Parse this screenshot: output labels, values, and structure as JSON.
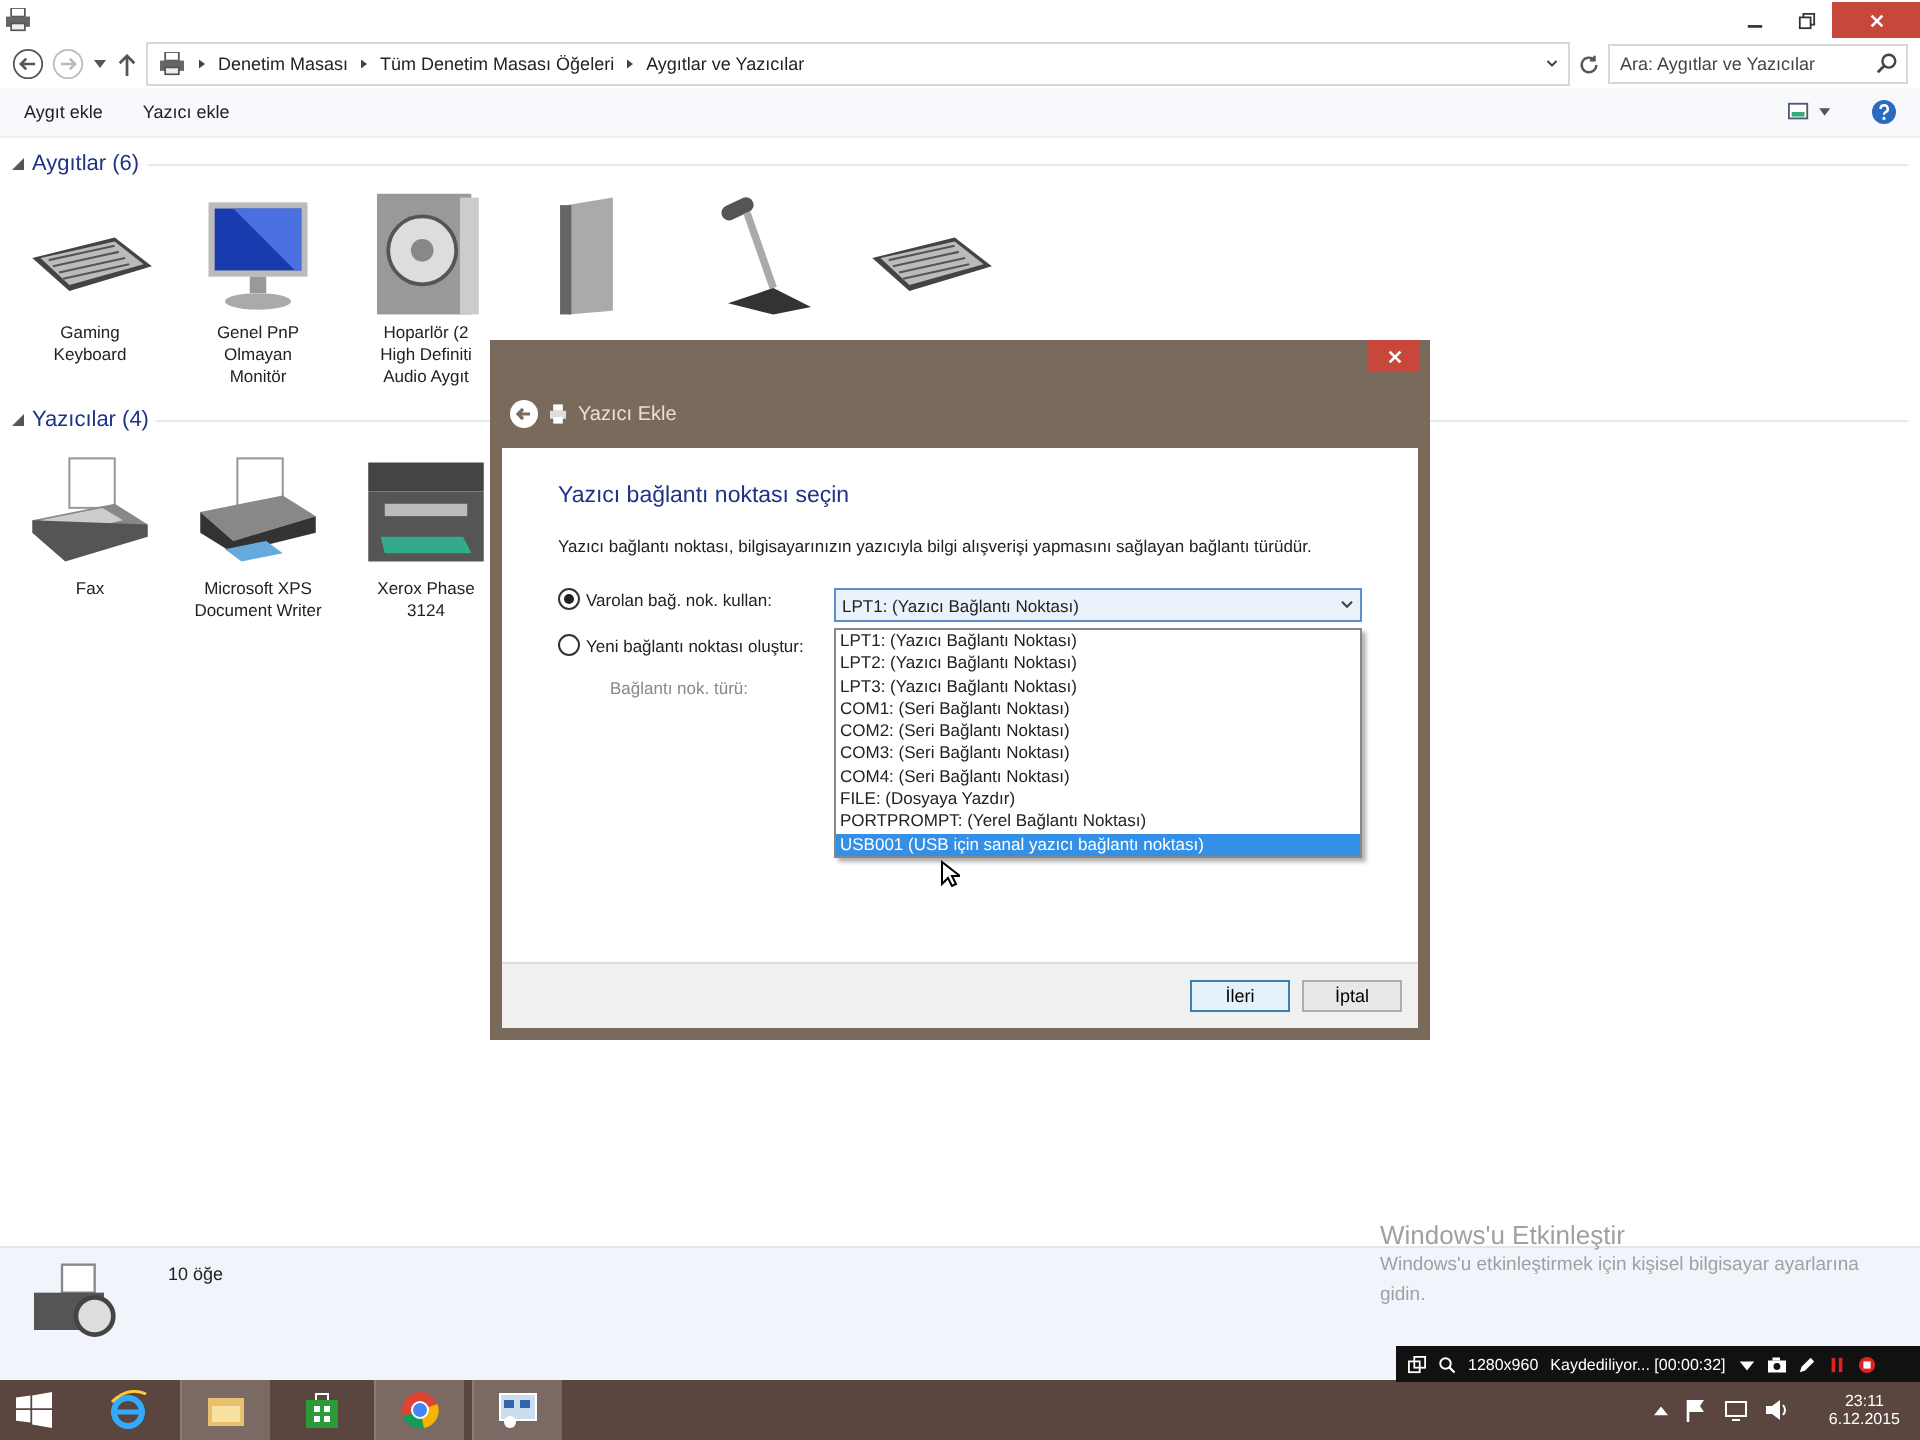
{
  "address_bar": {
    "breadcrumbs": [
      "Denetim Masası",
      "Tüm Denetim Masası Öğeleri",
      "Aygıtlar ve Yazıcılar"
    ],
    "search": {
      "placeholder": "Ara: Aygıtlar ve Yazıcılar"
    }
  },
  "command_bar": {
    "buttons": [
      "Aygıt ekle",
      "Yazıcı ekle"
    ]
  },
  "groups": [
    {
      "title": "Aygıtlar (6)",
      "items": [
        {
          "kind": "keyboard",
          "label": [
            "Gaming",
            "Keyboard"
          ]
        },
        {
          "kind": "monitor",
          "label": [
            "Genel PnP",
            "Olmayan",
            "Monitör"
          ]
        },
        {
          "kind": "speaker",
          "label": [
            "Hoparlör (2",
            "High Definiti",
            "Audio Aygıt"
          ]
        },
        {
          "kind": "tower"
        },
        {
          "kind": "microphone"
        },
        {
          "kind": "keyboard"
        }
      ]
    },
    {
      "title": "Yazıcılar (4)",
      "items": [
        {
          "kind": "fax",
          "label": [
            "Fax"
          ]
        },
        {
          "kind": "printer",
          "label": [
            "Microsoft XPS",
            "Document Writer"
          ]
        },
        {
          "kind": "mfp",
          "label": [
            "Xerox Phase",
            "3124"
          ]
        }
      ]
    }
  ],
  "status_bar": {
    "count": "10 öğe"
  },
  "dialog": {
    "title": "Yazıcı Ekle",
    "heading": "Yazıcı bağlantı noktası seçin",
    "description": "Yazıcı bağlantı noktası, bilgisayarınızın yazıcıyla bilgi alışverişi yapmasını sağlayan bağlantı türüdür.",
    "options": [
      {
        "label": "Varolan bağ. nok. kullan:",
        "selected": true
      },
      {
        "label": "Yeni bağlantı noktası oluştur:",
        "selected": false
      }
    ],
    "port_type_label": "Bağlantı nok. türü:",
    "combo_value": "LPT1: (Yazıcı Bağlantı Noktası)",
    "ports": [
      {
        "label": "LPT1: (Yazıcı Bağlantı Noktası)",
        "selected": false
      },
      {
        "label": "LPT2: (Yazıcı Bağlantı Noktası)",
        "selected": false
      },
      {
        "label": "LPT3: (Yazıcı Bağlantı Noktası)",
        "selected": false
      },
      {
        "label": "COM1: (Seri Bağlantı Noktası)",
        "selected": false
      },
      {
        "label": "COM2: (Seri Bağlantı Noktası)",
        "selected": false
      },
      {
        "label": "COM3: (Seri Bağlantı Noktası)",
        "selected": false
      },
      {
        "label": "COM4: (Seri Bağlantı Noktası)",
        "selected": false
      },
      {
        "label": "FILE: (Dosyaya Yazdır)",
        "selected": false
      },
      {
        "label": "PORTPROMPT: (Yerel Bağlantı Noktası)",
        "selected": false
      },
      {
        "label": "USB001 (USB için sanal yazıcı bağlantı noktası)",
        "selected": true
      }
    ],
    "buttons": [
      {
        "label": "İleri",
        "default": true
      },
      {
        "label": "İptal",
        "default": false
      }
    ]
  },
  "activation": {
    "title": "Windows'u Etkinleştir",
    "text": "Windows'u etkinleştirmek için kişisel bilgisayar ayarlarına gidin."
  },
  "recorder_bar": {
    "resolution": "1280x960",
    "status": "Kaydediliyor... [00:00:32]"
  },
  "taskbar": {
    "apps": [
      {
        "kind": "ie",
        "active": false
      },
      {
        "kind": "explorer",
        "active": true
      },
      {
        "kind": "store",
        "active": false
      },
      {
        "kind": "chrome",
        "active": true
      },
      {
        "kind": "devices",
        "active": true
      }
    ],
    "time": "23:11",
    "date": "6.12.2015"
  }
}
